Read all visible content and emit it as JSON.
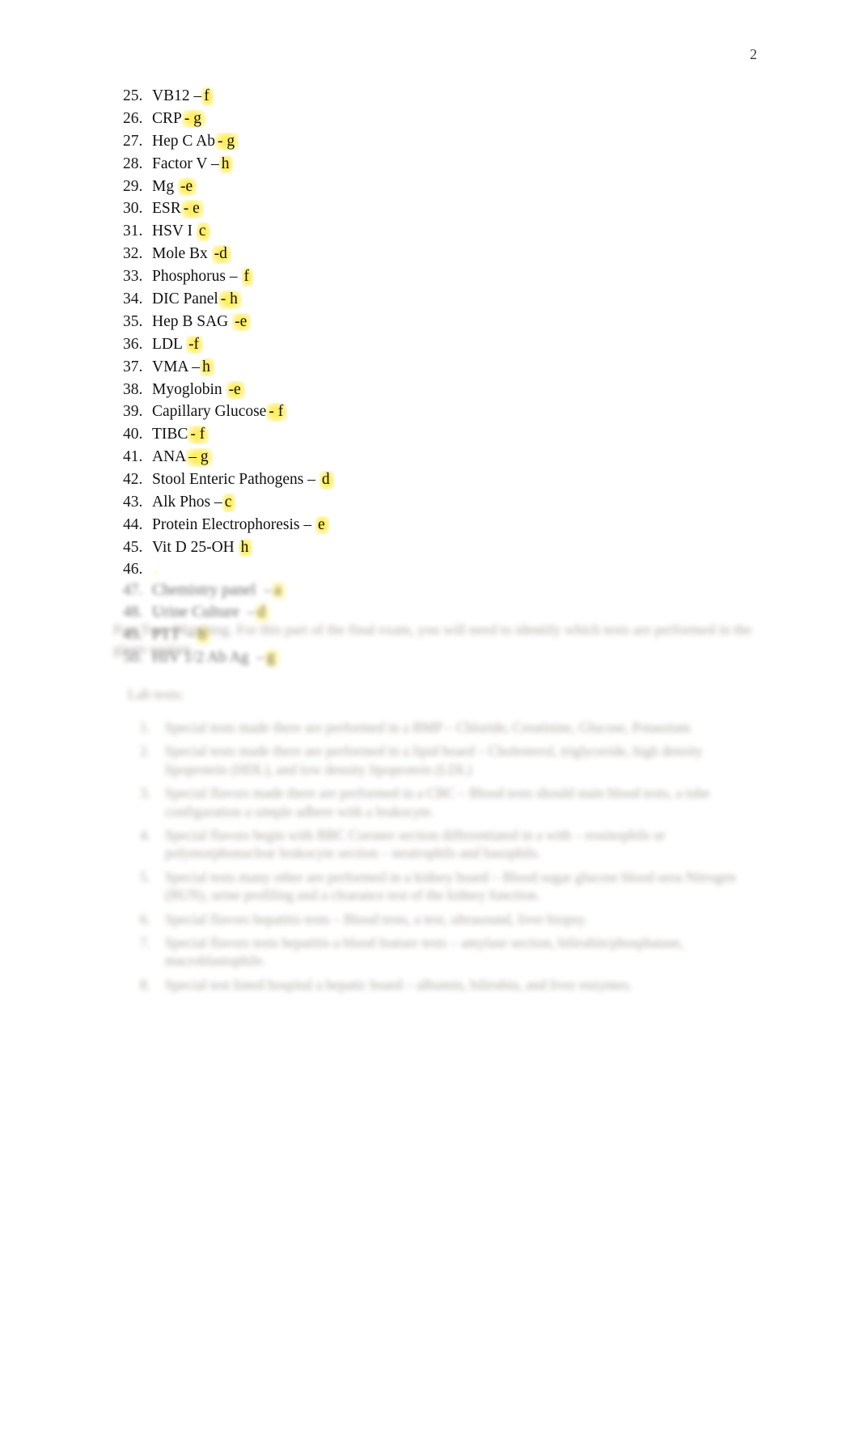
{
  "document": {
    "page_number": "2",
    "answers": [
      {
        "num": "25.",
        "text": "VB12 –",
        "answer": "f"
      },
      {
        "num": "26.",
        "text": "CRP",
        "answer": "- g"
      },
      {
        "num": "27.",
        "text": "Hep C Ab",
        "answer": "- g"
      },
      {
        "num": "28.",
        "text": "Factor V –",
        "answer": "h"
      },
      {
        "num": "29.",
        "text": "Mg ",
        "answer": "-e"
      },
      {
        "num": "30.",
        "text": "ESR",
        "answer": "- e"
      },
      {
        "num": "31.",
        "text": "HSV I ",
        "answer": "c"
      },
      {
        "num": "32.",
        "text": "Mole Bx ",
        "answer": "-d"
      },
      {
        "num": "33.",
        "text": "Phosphorus – ",
        "answer": "f"
      },
      {
        "num": "34.",
        "text": "DIC Panel",
        "answer": "- h"
      },
      {
        "num": "35.",
        "text": "Hep B SAG ",
        "answer": "-e"
      },
      {
        "num": "36.",
        "text": "LDL ",
        "answer": "-f"
      },
      {
        "num": "37.",
        "text": "VMA –",
        "answer": "h"
      },
      {
        "num": "38.",
        "text": "Myoglobin ",
        "answer": "-e"
      },
      {
        "num": "39.",
        "text": "Capillary Glucose",
        "answer": "- f"
      },
      {
        "num": "40.",
        "text": "TIBC",
        "answer": "- f"
      },
      {
        "num": "41.",
        "text": "ANA",
        "answer": "– g"
      },
      {
        "num": "42.",
        "text": "Stool Enteric Pathogens – ",
        "answer": "d"
      },
      {
        "num": "43.",
        "text": "Alk Phos –",
        "answer": "c"
      },
      {
        "num": "44.",
        "text": "Protein Electrophoresis – ",
        "answer": "e"
      },
      {
        "num": "45.",
        "text": "Vit D 25-OH ",
        "answer": "h"
      },
      {
        "num": "46.",
        "text": "",
        "answer": ""
      }
    ],
    "blurred_answers": [
      {
        "num": "47.",
        "text": "Chemistry panel  –",
        "answer": "a"
      },
      {
        "num": "48.",
        "text": "Urine Culture  –",
        "answer": "d"
      },
      {
        "num": "49.",
        "text": "PTT  –",
        "answer": "h"
      },
      {
        "num": "50.",
        "text": "HIV 1/2 Ab Ag  –",
        "answer": "g"
      }
    ],
    "paragraph": "Part Two: Matching. For this part of the final exam, you will need to identify which tests are performed in the given section.",
    "sub_head": "Lab tests:",
    "lower_list": [
      {
        "num": "1.",
        "text": "Special tests made there are performed in a BMP  –  Chloride,  Creatinine,  Glucose, Potassium"
      },
      {
        "num": "2.",
        "text": "Special tests made there are performed in a lipid board –  Cholesterol,  triglyceride, high density lipoprotein (HDL), and low density lipoprotein (LDL)"
      },
      {
        "num": "3.",
        "text": "Special flavors made there are performed in a CBC  – Blood tests should stain  blood tests, a tube configuration  a  simple adhere with  a leukocyte."
      },
      {
        "num": "4.",
        "text": "Special flavors begin with BBC Coroner section differentiated in a with  –  eosinophils or  polymorphonuclear leukocyte section  – neutrophils  and basophils."
      },
      {
        "num": "5.",
        "text": "Special tests many other are performed in a kidney board  –  Blood sugar glucose  blood urea Nitrogen (BUN),  urine profiling and  a clearance test of the kidney function."
      },
      {
        "num": "6.",
        "text": "Special flavors hepatitis tests  –  Blood tests, a test, ultrasound, liver biopsy."
      },
      {
        "num": "7.",
        "text": "Special flavors tests hepatitis a blood feature tests  –  amylase section,  bilirubin/phosphatase, macroblastophile."
      },
      {
        "num": "8.",
        "text": "Special test listed hospital a hepatic board –  albumin, bilirubin, and liver enzymes."
      }
    ]
  }
}
